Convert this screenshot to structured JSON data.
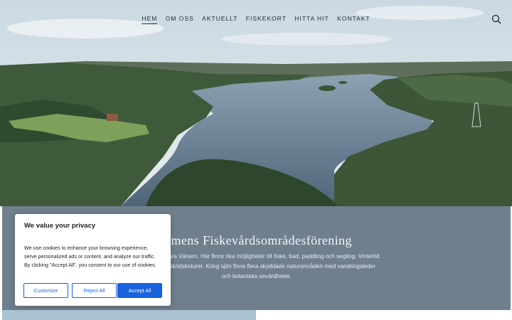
{
  "nav": {
    "items": [
      {
        "label": "HEM",
        "active": true
      },
      {
        "label": "OM OSS",
        "active": false
      },
      {
        "label": "AKTUELLT",
        "active": false
      },
      {
        "label": "FISKEKORT",
        "active": false
      },
      {
        "label": "HITTA HIT",
        "active": false
      },
      {
        "label": "KONTAKT",
        "active": false
      }
    ],
    "search_icon": "search-icon"
  },
  "intro": {
    "title": "mmens Fiskevårdsområdesförening",
    "lines": [
      "prickdalssjö nära Vänern. Här finns rika möjligheter till fiske, bad, paddling och segling. Vintertid",
      "pelfiske och skridskoturer. Kring sjön finns flera skyddade naturområden med vandringsleder",
      "och botaniska sevärdheter."
    ]
  },
  "cookie": {
    "title": "We value your privacy",
    "lines": [
      "We use cookies to enhance your browsing experience,",
      "serve personalized ads or content, and analyze our traffic.",
      "By clicking \"Accept All\", you consent to our use of cookies."
    ],
    "customize_label": "Customize",
    "reject_label": "Reject All",
    "accept_label": "Accept All"
  },
  "colors": {
    "band": "#6f7f8d",
    "accent": "#1863dc",
    "nav_text": "#1f2a33"
  }
}
